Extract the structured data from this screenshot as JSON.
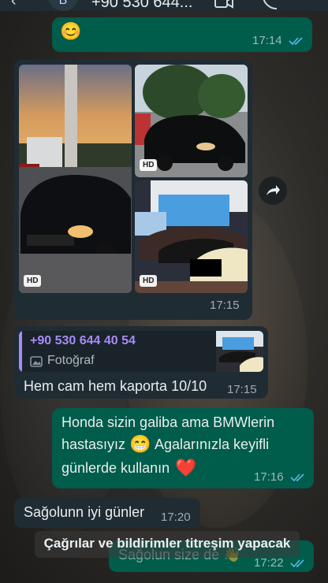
{
  "header": {
    "avatar_letter": "B",
    "contact_name": "+90 530 644..."
  },
  "messages": {
    "m1": {
      "emoji": "😊",
      "time": "17:14"
    },
    "album": {
      "time": "17:15",
      "hd_label": "HD"
    },
    "reply": {
      "quote_name": "+90 530 644 40 54",
      "quote_type": "Fotoğraf",
      "text": "Hem cam hem kaporta 10/10",
      "time": "17:15"
    },
    "m3": {
      "line1": "Honda sizin galiba ama BMWlerin",
      "line2a": "hastasıyız",
      "emoji1": "😁",
      "line2b": "Agalarınızla keyifli",
      "line3": "günlerde kullanın",
      "emoji2": "❤️",
      "time": "17:16"
    },
    "m4": {
      "text": "Sağolunn iyi günler",
      "time": "17:20"
    },
    "m5": {
      "text": "Sağolun size de 👋",
      "time": "17:22"
    }
  },
  "toast": {
    "text": "Çağrılar ve bildirimler titreşim yapacak"
  },
  "colors": {
    "outgoing": "#005c4b",
    "incoming": "#202c33",
    "read_ticks": "#53bdeb",
    "quote_bar": "#a78bfa"
  },
  "icons": [
    "back-arrow-icon",
    "video-call-icon",
    "phone-icon",
    "more-icon",
    "read-ticks-icon",
    "forward-icon",
    "photo-icon"
  ]
}
